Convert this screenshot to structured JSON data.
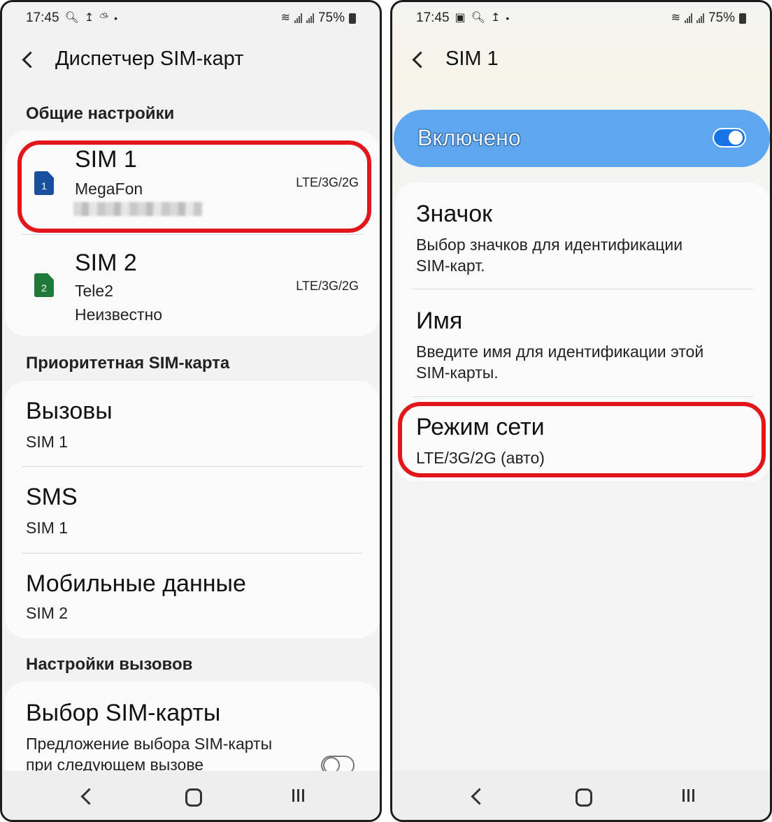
{
  "status_bar": {
    "left": {
      "time": "17:45"
    },
    "right": {
      "time": "17:45"
    },
    "battery": "75%"
  },
  "left_screen": {
    "title": "Диспетчер SIM-карт",
    "general_section": "Общие настройки",
    "sims": [
      {
        "name": "SIM 1",
        "operator": "MegaFon",
        "network": "LTE/3G/2G",
        "slot": "1",
        "color": "#1a4fa0"
      },
      {
        "name": "SIM 2",
        "operator": "Tele2",
        "extra": "Неизвестно",
        "network": "LTE/3G/2G",
        "slot": "2",
        "color": "#1f7a3a"
      }
    ],
    "priority_section": "Приоритетная SIM-карта",
    "priority": [
      {
        "title": "Вызовы",
        "value": "SIM 1"
      },
      {
        "title": "SMS",
        "value": "SIM 1"
      },
      {
        "title": "Мобильные данные",
        "value": "SIM 2"
      }
    ],
    "calls_section": "Настройки вызовов",
    "sim_choice": {
      "title": "Выбор SIM-карты",
      "desc_line1": "Предложение выбора SIM-карты",
      "desc_line2": "при следующем вызове",
      "enabled": false
    }
  },
  "right_screen": {
    "title": "SIM 1",
    "enabled_label": "Включено",
    "enabled": true,
    "items": [
      {
        "title": "Значок",
        "desc_line1": "Выбор значков для идентификации",
        "desc_line2": "SIM-карт."
      },
      {
        "title": "Имя",
        "desc_line1": "Введите имя для идентификации этой",
        "desc_line2": "SIM-карты."
      },
      {
        "title": "Режим сети",
        "value": "LTE/3G/2G (авто)"
      }
    ]
  },
  "colors": {
    "highlight": "#e3161b",
    "accent": "#1674e6",
    "enabled_bar": "#5ea7ef"
  },
  "icons": {
    "back": "chevron-left-icon",
    "search": "search-icon",
    "upload": "upload-icon",
    "weather": "weather-icon",
    "gallery": "gallery-icon",
    "wifi": "wifi-icon",
    "signal": "signal-icon",
    "battery": "battery-icon",
    "nav_back": "nav-back-icon",
    "nav_home": "nav-home-icon",
    "nav_recent": "nav-recent-icon"
  }
}
